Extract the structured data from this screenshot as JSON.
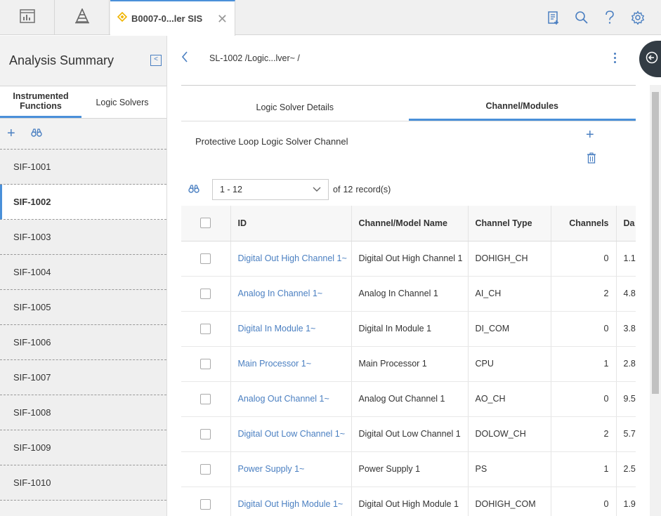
{
  "topbar": {
    "tab_title": "B0007-0...ler SIS",
    "close_symbol": "✕"
  },
  "left_panel": {
    "title": "Analysis Summary",
    "tabs": [
      {
        "label": "Instrumented Functions",
        "active": true
      },
      {
        "label": "Logic Solvers",
        "active": false
      }
    ],
    "items": [
      "SIF-1001",
      "SIF-1002",
      "SIF-1003",
      "SIF-1004",
      "SIF-1005",
      "SIF-1006",
      "SIF-1007",
      "SIF-1008",
      "SIF-1009",
      "SIF-1010"
    ],
    "active_item": "SIF-1002"
  },
  "main": {
    "breadcrumb": "SL-1002 /Logic...lver~ /",
    "tabs": [
      {
        "label": "Logic Solver Details",
        "active": false
      },
      {
        "label": "Channel/Modules",
        "active": true
      }
    ],
    "section_title": "Protective Loop Logic Solver Channel",
    "pager": {
      "range": "1 - 12",
      "of_label": "of",
      "total": "12",
      "records_label": "record(s)"
    },
    "table": {
      "columns": [
        "ID",
        "Channel/Model Name",
        "Channel Type",
        "Channels",
        "Da"
      ],
      "rows": [
        [
          "Digital Out High Channel 1~",
          "Digital Out High Channel 1",
          "DOHIGH_CH",
          "0",
          "1.1"
        ],
        [
          "Analog In Channel 1~",
          "Analog In Channel 1",
          "AI_CH",
          "2",
          "4.8"
        ],
        [
          "Digital In Module 1~",
          "Digital In Module 1",
          "DI_COM",
          "0",
          "3.8"
        ],
        [
          "Main Processor 1~",
          "Main Processor 1",
          "CPU",
          "1",
          "2.8"
        ],
        [
          "Analog Out Channel 1~",
          "Analog Out Channel 1",
          "AO_CH",
          "0",
          "9.5"
        ],
        [
          "Digital Out Low Channel 1~",
          "Digital Out Low Channel 1",
          "DOLOW_CH",
          "2",
          "5.7"
        ],
        [
          "Power Supply 1~",
          "Power Supply 1",
          "PS",
          "1",
          "2.5"
        ],
        [
          "Digital Out High Module 1~",
          "Digital Out High Module 1",
          "DOHIGH_COM",
          "0",
          "1.9"
        ]
      ]
    }
  },
  "colors": {
    "accent": "#4a90d9",
    "link": "#4a7fc1",
    "tab_diamond": "#f0b400"
  }
}
